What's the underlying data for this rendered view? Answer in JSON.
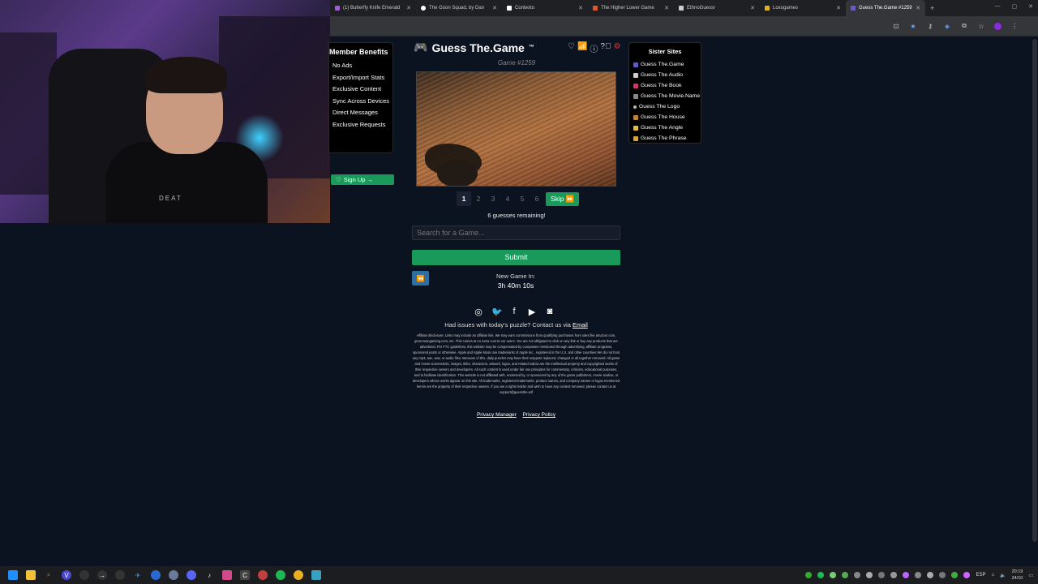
{
  "browser": {
    "tabs": [
      {
        "label": "(1) Butterfly Knife Emerald",
        "color": "#a35bd6"
      },
      {
        "label": "The Goon Squad, by Dan",
        "color": "#ffffff"
      },
      {
        "label": "Contexto",
        "color": "#ffffff"
      },
      {
        "label": "The Higher Lower Game",
        "color": "#e0582a"
      },
      {
        "label": "EthnoGuessr",
        "color": "#cccccc"
      },
      {
        "label": "Loxogames",
        "color": "#e0b02a"
      },
      {
        "label": "Guess The.Game #1259",
        "color": "#6a5acd"
      }
    ],
    "new_tab": "+"
  },
  "webcam": {
    "shirt_text": "DEAT"
  },
  "benefits": {
    "title": "Member Benefits",
    "items": [
      "No Ads",
      "Export/Import Stats",
      "Exclusive Content",
      "Sync Across Devices",
      "Direct Messages",
      "Exclusive Requests"
    ],
    "signup": "Sign Up →"
  },
  "sister": {
    "title": "Sister Sites",
    "items": [
      {
        "label": "Guess The.Game",
        "color": "#5b5bd6"
      },
      {
        "label": "Guess The Audio",
        "color": "#cccccc"
      },
      {
        "label": "Guess The Book",
        "color": "#d6336c"
      },
      {
        "label": "Guess The Movie.Name",
        "color": "#888888"
      },
      {
        "label": "Guess The Logo",
        "color": "#bbbbbb"
      },
      {
        "label": "Guess The House",
        "color": "#c9822b"
      },
      {
        "label": "Guess The Angle",
        "color": "#e0c040"
      },
      {
        "label": "Guess The Phrase",
        "color": "#d6a53a"
      }
    ]
  },
  "game": {
    "title": "Guess The.Game",
    "trademark": "™",
    "number": "Game #1259",
    "stages": [
      "1",
      "2",
      "3",
      "4",
      "5",
      "6"
    ],
    "active_stage": "1",
    "skip": "Skip ⏩",
    "remaining": "6 guesses remaining!",
    "search_placeholder": "Search for a Game...",
    "submit": "Submit",
    "new_game_label": "New Game In:",
    "timer": "3h 40m 10s"
  },
  "footer": {
    "issues_text": "Had issues with today's puzzle? Contact us via ",
    "email_link": "Email",
    "disclosure": "Affiliate disclosure: Links may include an affiliate link. We may earn commissions from qualifying purchases from sites like amazon.com, greenmangaming.com, etc. This comes at no extra cost to our users. You are not obligated to click on any link or buy any products that are advertised. Per FTC guidelines, this website may be compensated by companies mentioned through advertising, affiliate programs, sponsored posts or otherwise. Apple and Apple Music are trademarks of Apple Inc., registered in the U.S. and other countries We do not host any mp3, aac, wav, or audio files. Because of this, daily puzzles may have their snippets replaced, changed or all together removed. All game and movie screenshots, images, titles, characters, artwork, logos, and related indicia are the intellectual property and copyrighted works of their respective owners and developers. All such content is used under fair use principles for commentary, criticism, educational purposes, and to facilitate identification. This website is not affiliated with, endorsed by, or sponsored by any of the game publishers, movie studios, or developers whose works appear on this site. All trademarks, registered trademarks, product names, and company names or logos mentioned herein are the property of their respective owners. If you are a rights holder and wish to have any content removed, please contact us at support@guessthe.wtf",
    "privacy_manager": "Privacy Manager",
    "privacy_policy": "Privacy Policy"
  },
  "taskbar": {
    "lang": "ESP",
    "time": "20:19",
    "date": "24/10"
  }
}
